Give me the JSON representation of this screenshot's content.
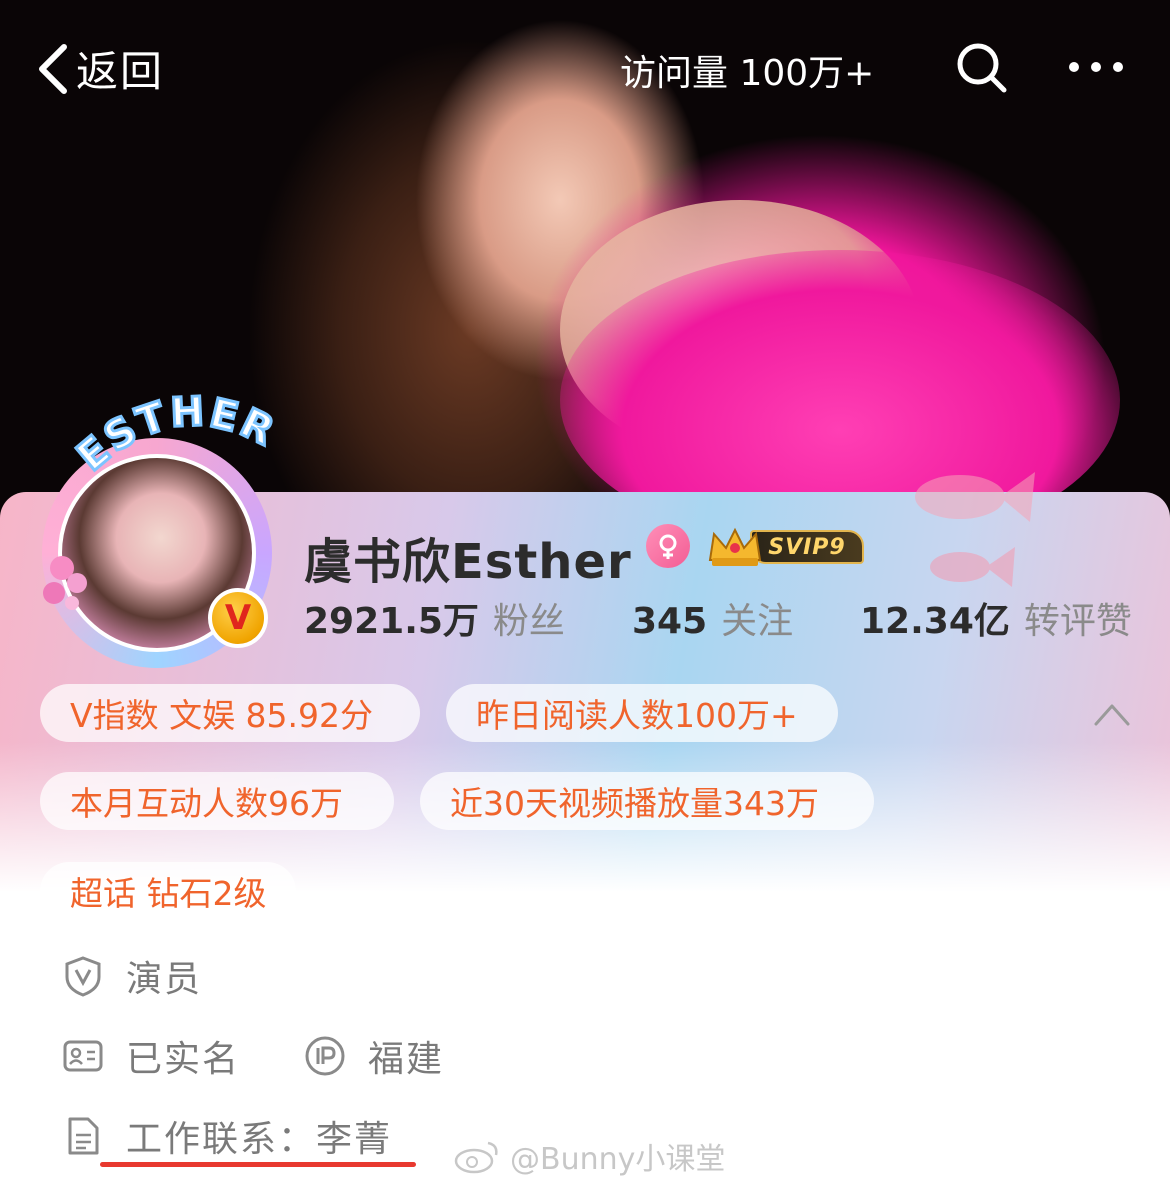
{
  "nav": {
    "back_label": "返回",
    "visits_label": "访问量 100万+"
  },
  "profile": {
    "avatar_frame_text": "ESTHER",
    "verified_badge": "V",
    "name": "虞书欣Esther",
    "vip_badge": "SVIP9",
    "stats": [
      {
        "value": "2921.5万",
        "label": "粉丝"
      },
      {
        "value": "345",
        "label": "关注"
      },
      {
        "value": "12.34亿",
        "label": "转评赞"
      }
    ]
  },
  "chips": [
    "V指数 文娱 85.92分",
    "昨日阅读人数100万+",
    "本月互动人数96万",
    "近30天视频播放量343万",
    "超话 钻石2级"
  ],
  "info": {
    "occupation": "演员",
    "realname": "已实名",
    "ip_location": "福建",
    "work_contact": "工作联系：李菁"
  },
  "watermark": "@Bunny小课堂",
  "colors": {
    "accent_orange": "#f0642c",
    "underline_red": "#e8392f",
    "dress_pink": "#f0189d"
  },
  "icons": [
    "back-chevron-icon",
    "search-icon",
    "more-dots-icon",
    "female-gender-icon",
    "svip-crown-icon",
    "verified-v-icon",
    "chevron-up-icon",
    "shield-v-icon",
    "id-card-icon",
    "ip-icon",
    "document-icon",
    "weibo-logo-icon"
  ]
}
